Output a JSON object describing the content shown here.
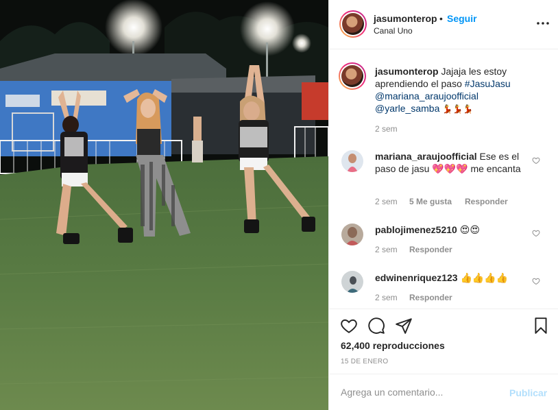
{
  "header": {
    "username": "jasumonterop",
    "separator": "•",
    "follow_label": "Seguir",
    "location": "Canal Uno",
    "more_icon": "more-horizontal-icon"
  },
  "caption": {
    "username": "jasumonterop",
    "text": "Jajaja les estoy aprendiendo el paso",
    "hashtag": "#JasuJasu",
    "mention1": "@mariana_araujoofficial",
    "mention2": "@yarle_samba",
    "emoji": "💃💃💃",
    "time": "2 sem"
  },
  "comments": [
    {
      "username": "mariana_araujoofficial",
      "text": "Ese es el paso de jasu 💖💖💖 me encanta",
      "time": "2 sem",
      "likes": "5 Me gusta",
      "reply": "Responder"
    },
    {
      "username": "pablojimenez5210",
      "text": "😍😍",
      "time": "2 sem",
      "reply": "Responder"
    },
    {
      "username": "edwinenriquez123",
      "text": "👍👍👍👍",
      "time": "2 sem",
      "reply": "Responder"
    }
  ],
  "actions": {
    "like_icon": "heart-icon",
    "comment_icon": "comment-icon",
    "share_icon": "share-icon",
    "save_icon": "bookmark-icon",
    "views": "62,400 reproducciones",
    "date": "15 DE ENERO"
  },
  "add_comment": {
    "placeholder": "Agrega un comentario...",
    "publish_label": "Publicar"
  },
  "colors": {
    "link": "#0095f6",
    "hashtag": "#00376b",
    "muted": "#8e8e8e",
    "publish_disabled": "#b2dffc"
  }
}
